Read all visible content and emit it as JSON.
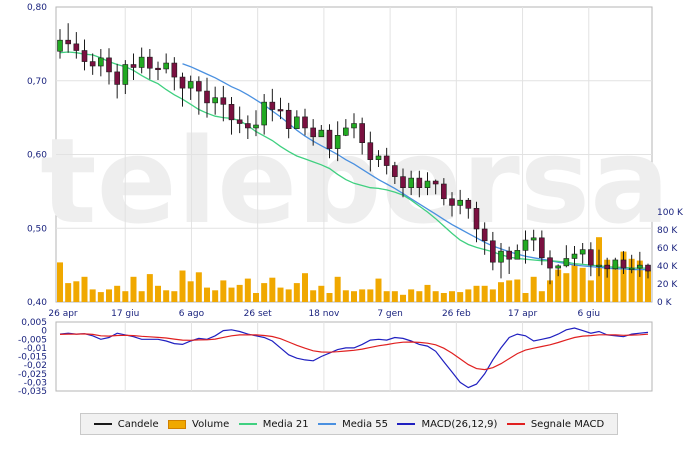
{
  "chart_data": [
    {
      "type": "candlestick",
      "x_tick_labels": [
        "26 apr",
        "17 giu",
        "6 ago",
        "26 set",
        "18 nov",
        "7 gen",
        "26 feb",
        "17 apr",
        "6 giu"
      ],
      "y_tick_labels": [
        "0,80",
        "0,70",
        "0,60",
        "0,50",
        "0,40"
      ],
      "ylim": [
        0.4,
        0.8
      ],
      "grid": true,
      "watermark": "telebersa",
      "series": [
        {
          "name": "Candele",
          "color": "#1a1a1a",
          "up_color": "#22aa22",
          "down_color": "#7a1040",
          "candles": [
            [
              0.74,
              0.755,
              0.77,
              0.73
            ],
            [
              0.755,
              0.75,
              0.778,
              0.738
            ],
            [
              0.75,
              0.741,
              0.766,
              0.73
            ],
            [
              0.741,
              0.726,
              0.756,
              0.714
            ],
            [
              0.726,
              0.72,
              0.737,
              0.708
            ],
            [
              0.72,
              0.731,
              0.743,
              0.706
            ],
            [
              0.731,
              0.712,
              0.744,
              0.695
            ],
            [
              0.712,
              0.695,
              0.723,
              0.676
            ],
            [
              0.695,
              0.722,
              0.728,
              0.682
            ],
            [
              0.722,
              0.718,
              0.737,
              0.701
            ],
            [
              0.718,
              0.732,
              0.745,
              0.71
            ],
            [
              0.732,
              0.717,
              0.743,
              0.702
            ],
            [
              0.717,
              0.716,
              0.726,
              0.701
            ],
            [
              0.716,
              0.724,
              0.737,
              0.71
            ],
            [
              0.724,
              0.705,
              0.732,
              0.687
            ],
            [
              0.705,
              0.69,
              0.711,
              0.665
            ],
            [
              0.69,
              0.699,
              0.707,
              0.674
            ],
            [
              0.699,
              0.686,
              0.706,
              0.654
            ],
            [
              0.686,
              0.67,
              0.704,
              0.65
            ],
            [
              0.67,
              0.677,
              0.692,
              0.654
            ],
            [
              0.677,
              0.668,
              0.693,
              0.645
            ],
            [
              0.668,
              0.647,
              0.678,
              0.627
            ],
            [
              0.647,
              0.642,
              0.665,
              0.629
            ],
            [
              0.642,
              0.636,
              0.653,
              0.621
            ],
            [
              0.636,
              0.64,
              0.66,
              0.625
            ],
            [
              0.64,
              0.671,
              0.682,
              0.627
            ],
            [
              0.671,
              0.661,
              0.689,
              0.645
            ],
            [
              0.661,
              0.66,
              0.677,
              0.648
            ],
            [
              0.66,
              0.635,
              0.67,
              0.622
            ],
            [
              0.635,
              0.651,
              0.66,
              0.639
            ],
            [
              0.651,
              0.636,
              0.662,
              0.626
            ],
            [
              0.636,
              0.624,
              0.648,
              0.612
            ],
            [
              0.624,
              0.633,
              0.64,
              0.624
            ],
            [
              0.633,
              0.608,
              0.641,
              0.595
            ],
            [
              0.608,
              0.626,
              0.645,
              0.591
            ],
            [
              0.626,
              0.636,
              0.648,
              0.625
            ],
            [
              0.636,
              0.642,
              0.656,
              0.622
            ],
            [
              0.642,
              0.616,
              0.65,
              0.6
            ],
            [
              0.616,
              0.593,
              0.631,
              0.577
            ],
            [
              0.593,
              0.598,
              0.606,
              0.583
            ],
            [
              0.598,
              0.585,
              0.609,
              0.573
            ],
            [
              0.585,
              0.57,
              0.59,
              0.56
            ],
            [
              0.57,
              0.555,
              0.581,
              0.542
            ],
            [
              0.555,
              0.568,
              0.578,
              0.545
            ],
            [
              0.568,
              0.555,
              0.578,
              0.542
            ],
            [
              0.555,
              0.564,
              0.576,
              0.545
            ],
            [
              0.564,
              0.56,
              0.566,
              0.546
            ],
            [
              0.56,
              0.54,
              0.568,
              0.531
            ],
            [
              0.54,
              0.531,
              0.549,
              0.516
            ],
            [
              0.531,
              0.538,
              0.552,
              0.519
            ],
            [
              0.538,
              0.527,
              0.541,
              0.513
            ],
            [
              0.527,
              0.499,
              0.536,
              0.481
            ],
            [
              0.499,
              0.483,
              0.508,
              0.464
            ],
            [
              0.483,
              0.454,
              0.495,
              0.443
            ],
            [
              0.454,
              0.469,
              0.48,
              0.432
            ],
            [
              0.469,
              0.458,
              0.475,
              0.438
            ],
            [
              0.458,
              0.47,
              0.478,
              0.458
            ],
            [
              0.47,
              0.484,
              0.497,
              0.452
            ],
            [
              0.484,
              0.487,
              0.498,
              0.469
            ],
            [
              0.487,
              0.46,
              0.497,
              0.45
            ],
            [
              0.46,
              0.446,
              0.47,
              0.424
            ],
            [
              0.446,
              0.449,
              0.451,
              0.435
            ],
            [
              0.449,
              0.459,
              0.477,
              0.447
            ],
            [
              0.459,
              0.465,
              0.476,
              0.449
            ],
            [
              0.465,
              0.471,
              0.48,
              0.452
            ],
            [
              0.471,
              0.45,
              0.481,
              0.435
            ],
            [
              0.45,
              0.45,
              0.471,
              0.435
            ],
            [
              0.45,
              0.445,
              0.46,
              0.433
            ],
            [
              0.445,
              0.457,
              0.46,
              0.444
            ],
            [
              0.457,
              0.446,
              0.469,
              0.438
            ],
            [
              0.446,
              0.446,
              0.464,
              0.439
            ],
            [
              0.446,
              0.45,
              0.468,
              0.434
            ],
            [
              0.45,
              0.442,
              0.452,
              0.432
            ]
          ]
        },
        {
          "name": "Media 21",
          "color": "#40d080",
          "values": [
            0.738,
            0.739,
            0.738,
            0.736,
            0.735,
            0.731,
            0.726,
            0.722,
            0.719,
            0.714,
            0.707,
            0.701,
            0.696,
            0.688,
            0.681,
            0.675,
            0.668,
            0.661,
            0.656,
            0.652,
            0.65,
            0.649,
            0.646,
            0.639,
            0.631,
            0.625,
            0.619,
            0.611,
            0.604,
            0.598,
            0.594,
            0.59,
            0.586,
            0.581,
            0.573,
            0.566,
            0.561,
            0.558,
            0.555,
            0.554,
            0.552,
            0.549,
            0.545,
            0.538,
            0.53,
            0.522,
            0.513,
            0.503,
            0.493,
            0.484,
            0.478,
            0.474,
            0.471,
            0.468,
            0.464,
            0.461,
            0.459,
            0.458,
            0.457,
            0.456,
            0.456,
            0.455,
            0.454,
            0.452,
            0.451,
            0.45,
            0.449,
            0.448,
            0.447,
            0.447,
            0.446,
            0.446,
            0.446
          ]
        },
        {
          "name": "Media 55",
          "color": "#4a90e0",
          "values": [
            null,
            null,
            null,
            null,
            null,
            null,
            null,
            null,
            null,
            null,
            null,
            null,
            null,
            null,
            null,
            0.723,
            0.719,
            0.714,
            0.709,
            0.704,
            0.698,
            0.692,
            0.687,
            0.681,
            0.674,
            0.667,
            0.659,
            0.651,
            0.642,
            0.633,
            0.625,
            0.618,
            0.612,
            0.606,
            0.6,
            0.593,
            0.587,
            0.58,
            0.573,
            0.566,
            0.56,
            0.554,
            0.547,
            0.54,
            0.533,
            0.526,
            0.519,
            0.512,
            0.505,
            0.499,
            0.493,
            0.487,
            0.481,
            0.476,
            0.472,
            0.468,
            0.465,
            0.462,
            0.46,
            0.458,
            0.456,
            0.454,
            0.452,
            0.45,
            0.449,
            0.448,
            0.447,
            0.446,
            0.445,
            0.445,
            0.444,
            0.444,
            0.444
          ]
        }
      ]
    },
    {
      "type": "bar",
      "y_tick_labels": [
        "100 K",
        "80 K",
        "60 K",
        "40 K",
        "20 K",
        "0 K"
      ],
      "ylim": [
        0,
        100
      ],
      "series": [
        {
          "name": "Volume",
          "unit": "K",
          "color": "#f0a800",
          "values": [
            44,
            21,
            23,
            28,
            14,
            11,
            14,
            18,
            12,
            28,
            12,
            31,
            18,
            13,
            12,
            35,
            23,
            33,
            16,
            13,
            24,
            16,
            19,
            26,
            10,
            21,
            27,
            16,
            14,
            21,
            32,
            13,
            18,
            10,
            28,
            13,
            12,
            14,
            14,
            26,
            12,
            12,
            8,
            14,
            12,
            19,
            12,
            10,
            12,
            11,
            14,
            18,
            18,
            14,
            22,
            24,
            25,
            10,
            28,
            12,
            24,
            36,
            32,
            42,
            38,
            24,
            72,
            47,
            42,
            56,
            48,
            46,
            35
          ]
        }
      ]
    },
    {
      "type": "line",
      "y_tick_labels": [
        "0,005",
        "0",
        "-0,005",
        "-0,01",
        "-0,015",
        "-0,02",
        "-0,025",
        "-0,03",
        "-0,035"
      ],
      "ylim": [
        -0.035,
        0.005
      ],
      "series": [
        {
          "name": "MACD(26,12,9)",
          "color": "#2020c0",
          "values": [
            -0.002,
            -0.0015,
            -0.002,
            -0.0018,
            -0.003,
            -0.005,
            -0.004,
            -0.0015,
            -0.0025,
            -0.0035,
            -0.005,
            -0.005,
            -0.005,
            -0.006,
            -0.0075,
            -0.008,
            -0.006,
            -0.0045,
            -0.005,
            -0.003,
            0.0,
            0.0005,
            -0.0005,
            -0.002,
            -0.003,
            -0.004,
            -0.006,
            -0.01,
            -0.014,
            -0.016,
            -0.017,
            -0.0175,
            -0.015,
            -0.013,
            -0.011,
            -0.01,
            -0.01,
            -0.008,
            -0.0055,
            -0.005,
            -0.0055,
            -0.004,
            -0.0045,
            -0.006,
            -0.008,
            -0.009,
            -0.012,
            -0.018,
            -0.024,
            -0.03,
            -0.033,
            -0.031,
            -0.025,
            -0.017,
            -0.01,
            -0.004,
            -0.002,
            -0.003,
            -0.006,
            -0.005,
            -0.004,
            -0.002,
            0.0005,
            0.0015,
            0.0,
            -0.0015,
            -0.0005,
            -0.0025,
            -0.003,
            -0.0035,
            -0.002,
            -0.0015,
            -0.001
          ]
        },
        {
          "name": "Segnale MACD",
          "color": "#e02020",
          "values": [
            -0.0022,
            -0.002,
            -0.002,
            -0.0019,
            -0.0022,
            -0.003,
            -0.0032,
            -0.0028,
            -0.0027,
            -0.0029,
            -0.0033,
            -0.0036,
            -0.0039,
            -0.0043,
            -0.0049,
            -0.0055,
            -0.0056,
            -0.0054,
            -0.0053,
            -0.0049,
            -0.0039,
            -0.003,
            -0.0025,
            -0.0024,
            -0.0025,
            -0.0028,
            -0.0034,
            -0.0047,
            -0.0066,
            -0.0085,
            -0.0102,
            -0.0117,
            -0.0124,
            -0.0125,
            -0.0122,
            -0.0118,
            -0.0114,
            -0.0107,
            -0.0097,
            -0.0088,
            -0.0081,
            -0.0073,
            -0.0067,
            -0.0066,
            -0.0068,
            -0.0073,
            -0.0082,
            -0.0102,
            -0.013,
            -0.0164,
            -0.0197,
            -0.022,
            -0.0226,
            -0.0215,
            -0.0192,
            -0.0162,
            -0.0133,
            -0.0113,
            -0.0102,
            -0.0092,
            -0.0082,
            -0.0069,
            -0.0054,
            -0.004,
            -0.0032,
            -0.0029,
            -0.0024,
            -0.0024,
            -0.0025,
            -0.0027,
            -0.0026,
            -0.0024,
            -0.0021
          ]
        }
      ]
    }
  ]
}
